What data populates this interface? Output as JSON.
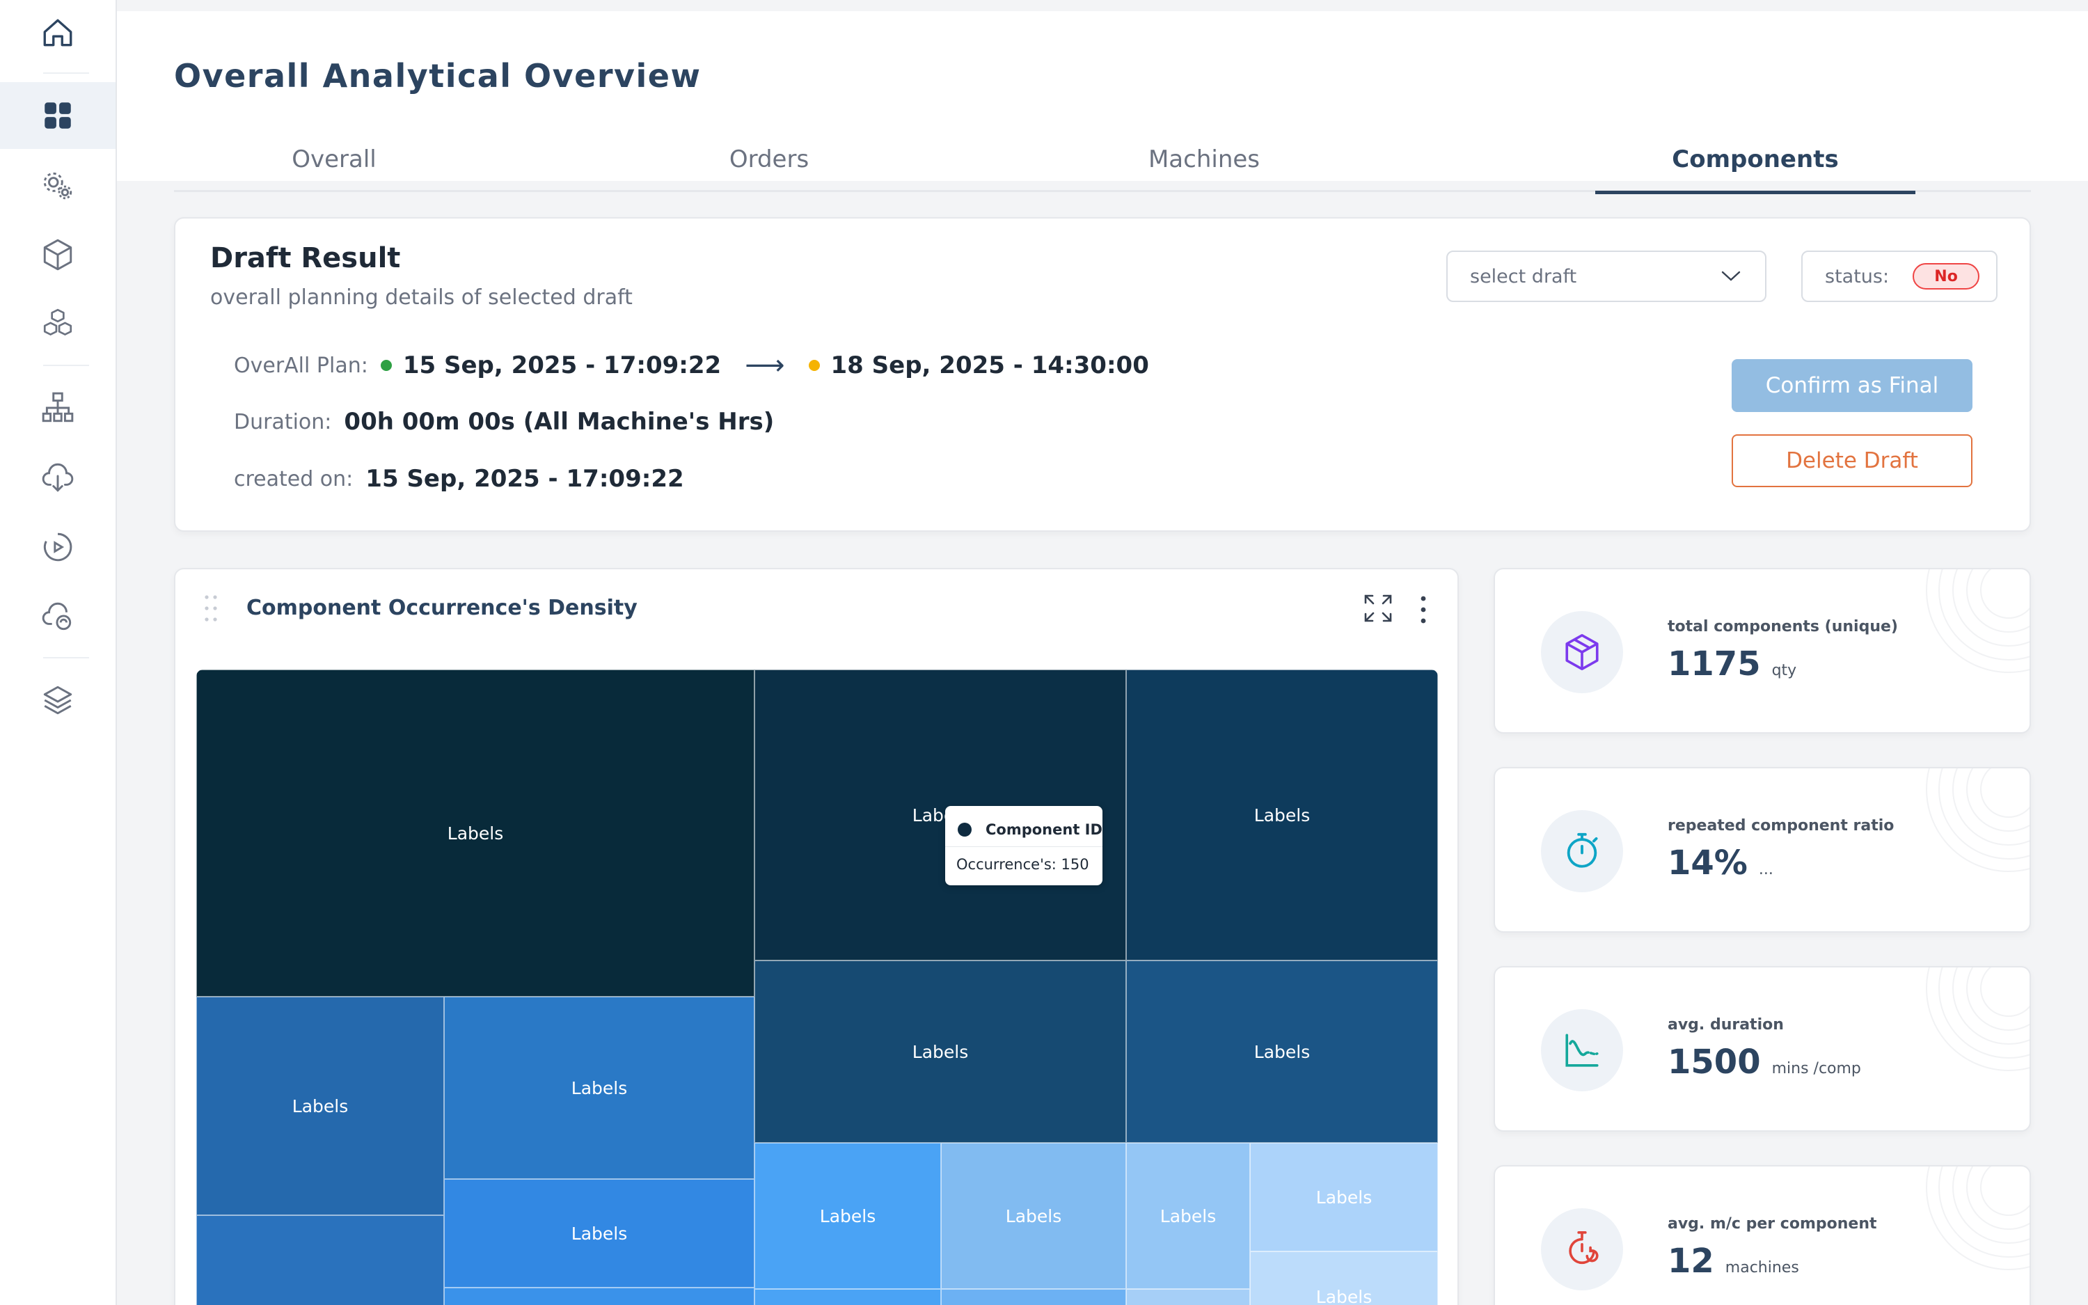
{
  "page": {
    "title": "Overall Analytical Overview"
  },
  "tabs": [
    {
      "label": "Overall",
      "active": false
    },
    {
      "label": "Orders",
      "active": false
    },
    {
      "label": "Machines",
      "active": false
    },
    {
      "label": "Components",
      "active": true
    }
  ],
  "sidebar": {
    "items": [
      {
        "icon": "home-icon",
        "active": false
      },
      {
        "icon": "dashboard-grid-icon",
        "active": true
      },
      {
        "icon": "gears-icon",
        "active": false
      },
      {
        "icon": "box-icon",
        "active": false
      },
      {
        "icon": "boxes-icon",
        "active": false
      },
      {
        "icon": "hierarchy-icon",
        "active": false
      },
      {
        "icon": "cloud-download-icon",
        "active": false
      },
      {
        "icon": "play-circle-icon",
        "active": false
      },
      {
        "icon": "cloud-sync-icon",
        "active": false
      },
      {
        "icon": "layers-icon",
        "active": false
      }
    ]
  },
  "draft": {
    "title": "Draft Result",
    "subtitle": "overall planning details of selected draft",
    "plan_label": "OverAll Plan:",
    "plan_start": "15 Sep, 2025 - 17:09:22",
    "plan_end": "18 Sep, 2025 - 14:30:00",
    "duration_label": "Duration:",
    "duration_value": "00h 00m 00s (All Machine's Hrs)",
    "created_label": "created on:",
    "created_value": "15 Sep, 2025 - 17:09:22",
    "select_placeholder": "select draft",
    "status_label": "status:",
    "status_value": "No",
    "confirm_label": "Confirm as Final",
    "delete_label": "Delete Draft",
    "colors": {
      "start_dot": "#2ea043",
      "end_dot": "#f5b301",
      "confirm": "#93bde2",
      "delete": "#e2733f"
    }
  },
  "treemap": {
    "title": "Component Occurrence's Density",
    "tile_label": "Labels",
    "tooltip": {
      "title": "Component ID",
      "body": "Occurrence's: 150"
    }
  },
  "stats": [
    {
      "label": "total components (unique)",
      "value": "1175",
      "unit": "qty",
      "icon": "cube-icon",
      "icon_color": "#7c3aed"
    },
    {
      "label": "repeated component ratio",
      "value": "14%",
      "unit": "...",
      "icon": "stopwatch-icon",
      "icon_color": "#0ea5c6"
    },
    {
      "label": "avg. duration",
      "value": "1500",
      "unit": "mins /comp",
      "icon": "curve-chart-icon",
      "icon_color": "#14a89b"
    },
    {
      "label": "avg. m/c per component",
      "value": "12",
      "unit": "machines",
      "icon": "timer-refresh-icon",
      "icon_color": "#e0453a"
    }
  ]
}
